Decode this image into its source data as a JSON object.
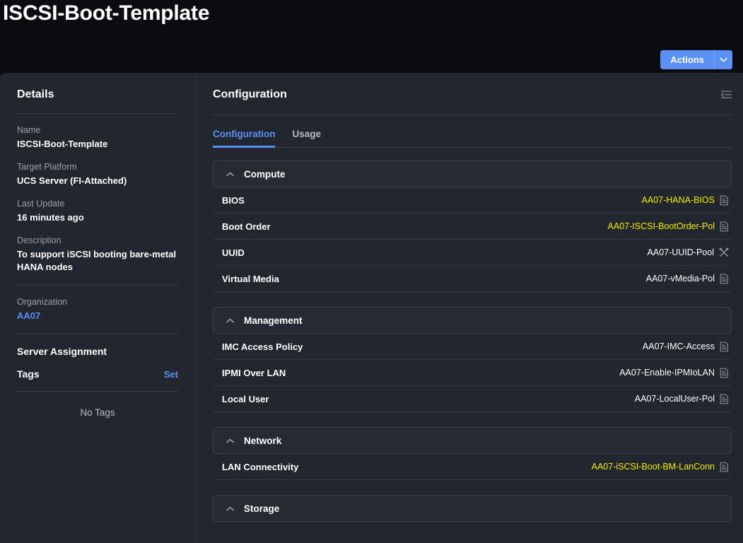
{
  "header": {
    "title": "ISCSI-Boot-Template",
    "actions_label": "Actions",
    "actions_caret_icon": "chevron-down-icon"
  },
  "details": {
    "title": "Details",
    "fields": [
      {
        "label": "Name",
        "value": "ISCSI-Boot-Template"
      },
      {
        "label": "Target Platform",
        "value": "UCS Server (FI-Attached)"
      },
      {
        "label": "Last Update",
        "value": "16 minutes ago"
      },
      {
        "label": "Description",
        "value": "To support iSCSI booting bare-metal HANA nodes"
      },
      {
        "label": "Organization",
        "value": "AA07"
      }
    ],
    "server_assignment_label": "Server Assignment",
    "tags_label": "Tags",
    "tags_set_label": "Set",
    "no_tags_label": "No Tags"
  },
  "configuration": {
    "title": "Configuration",
    "collapse_icon": "collapse-panel-icon",
    "tabs": [
      {
        "label": "Configuration",
        "active": true
      },
      {
        "label": "Usage",
        "active": false
      }
    ],
    "groups": [
      {
        "title": "Compute",
        "caret_icon": "chevron-up-icon",
        "rows": [
          {
            "label": "BIOS",
            "value": "AA07-HANA-BIOS",
            "highlight": true,
            "icon": "policy-icon"
          },
          {
            "label": "Boot Order",
            "value": "AA07-ISCSI-BootOrder-Pol",
            "highlight": true,
            "icon": "policy-icon"
          },
          {
            "label": "UUID",
            "value": "AA07-UUID-Pool",
            "highlight": false,
            "icon": "pool-icon"
          },
          {
            "label": "Virtual Media",
            "value": "AA07-vMedia-Pol",
            "highlight": false,
            "icon": "policy-icon"
          }
        ]
      },
      {
        "title": "Management",
        "caret_icon": "chevron-up-icon",
        "rows": [
          {
            "label": "IMC Access Policy",
            "value": "AA07-IMC-Access",
            "highlight": false,
            "icon": "policy-icon"
          },
          {
            "label": "IPMI Over LAN",
            "value": "AA07-Enable-IPMIoLAN",
            "highlight": false,
            "icon": "policy-icon"
          },
          {
            "label": "Local User",
            "value": "AA07-LocalUser-Pol",
            "highlight": false,
            "icon": "policy-icon"
          }
        ]
      },
      {
        "title": "Network",
        "caret_icon": "chevron-up-icon",
        "rows": [
          {
            "label": "LAN Connectivity",
            "value": "AA07-iSCSI-Boot-BM-LanConn",
            "highlight": true,
            "icon": "policy-icon"
          }
        ]
      },
      {
        "title": "Storage",
        "caret_icon": "chevron-up-icon",
        "rows": []
      }
    ]
  },
  "colors": {
    "accent": "#5b91f5",
    "highlight": "#f5f000",
    "panel_bg": "#22262e",
    "topbar_bg": "#0b0c0f"
  }
}
